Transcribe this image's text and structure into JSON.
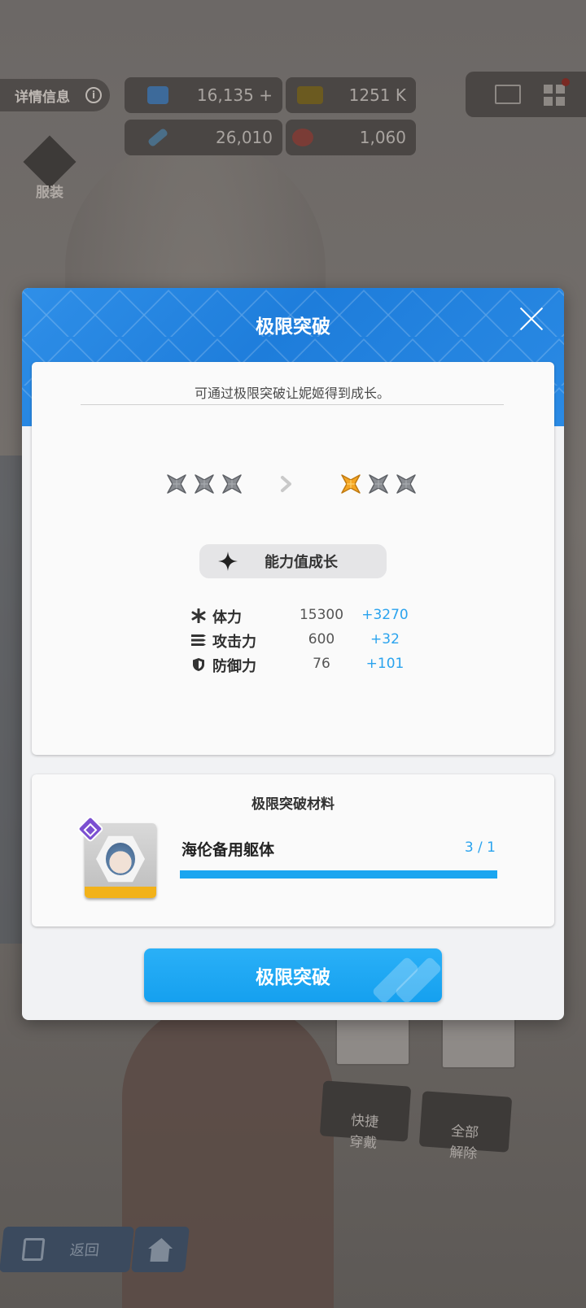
{
  "hud": {
    "details_label": "详情信息",
    "details_info_icon": "i",
    "resources": [
      {
        "icon": "crystal-icon",
        "value": "16,135 +"
      },
      {
        "icon": "ticket-icon",
        "value": "1251 K"
      },
      {
        "icon": "syringe-icon",
        "value": "26,010"
      },
      {
        "icon": "orb-icon",
        "value": "1,060"
      }
    ],
    "costume_label": "服装",
    "quick_equip": "快捷\n穿戴",
    "unequip_all": "全部\n解除",
    "back_label": "返回"
  },
  "modal": {
    "title": "极限突破",
    "description": "可通过极限突破让妮姬得到成长。",
    "stars_before": {
      "filled": 0,
      "total": 3
    },
    "stars_after": {
      "filled": 1,
      "total": 3
    },
    "growth_label": "能力值成长",
    "stats": [
      {
        "icon": "asterisk-icon",
        "name": "体力",
        "value": "15300",
        "increase": "+3270"
      },
      {
        "icon": "bullets-icon",
        "name": "攻击力",
        "value": "600",
        "increase": "+32"
      },
      {
        "icon": "shield-icon",
        "name": "防御力",
        "value": "76",
        "increase": "+101"
      }
    ],
    "materials_title": "极限突破材料",
    "material": {
      "name": "海伦备用躯体",
      "count": "3 / 1",
      "progress": 1.0
    },
    "confirm_label": "极限突破"
  },
  "colors": {
    "accent": "#1aa6f0",
    "header_blue": "#1e7ddb",
    "star_gold": "#f5a623",
    "star_empty": "#8a8d92",
    "increase_text": "#2aa3ee"
  }
}
